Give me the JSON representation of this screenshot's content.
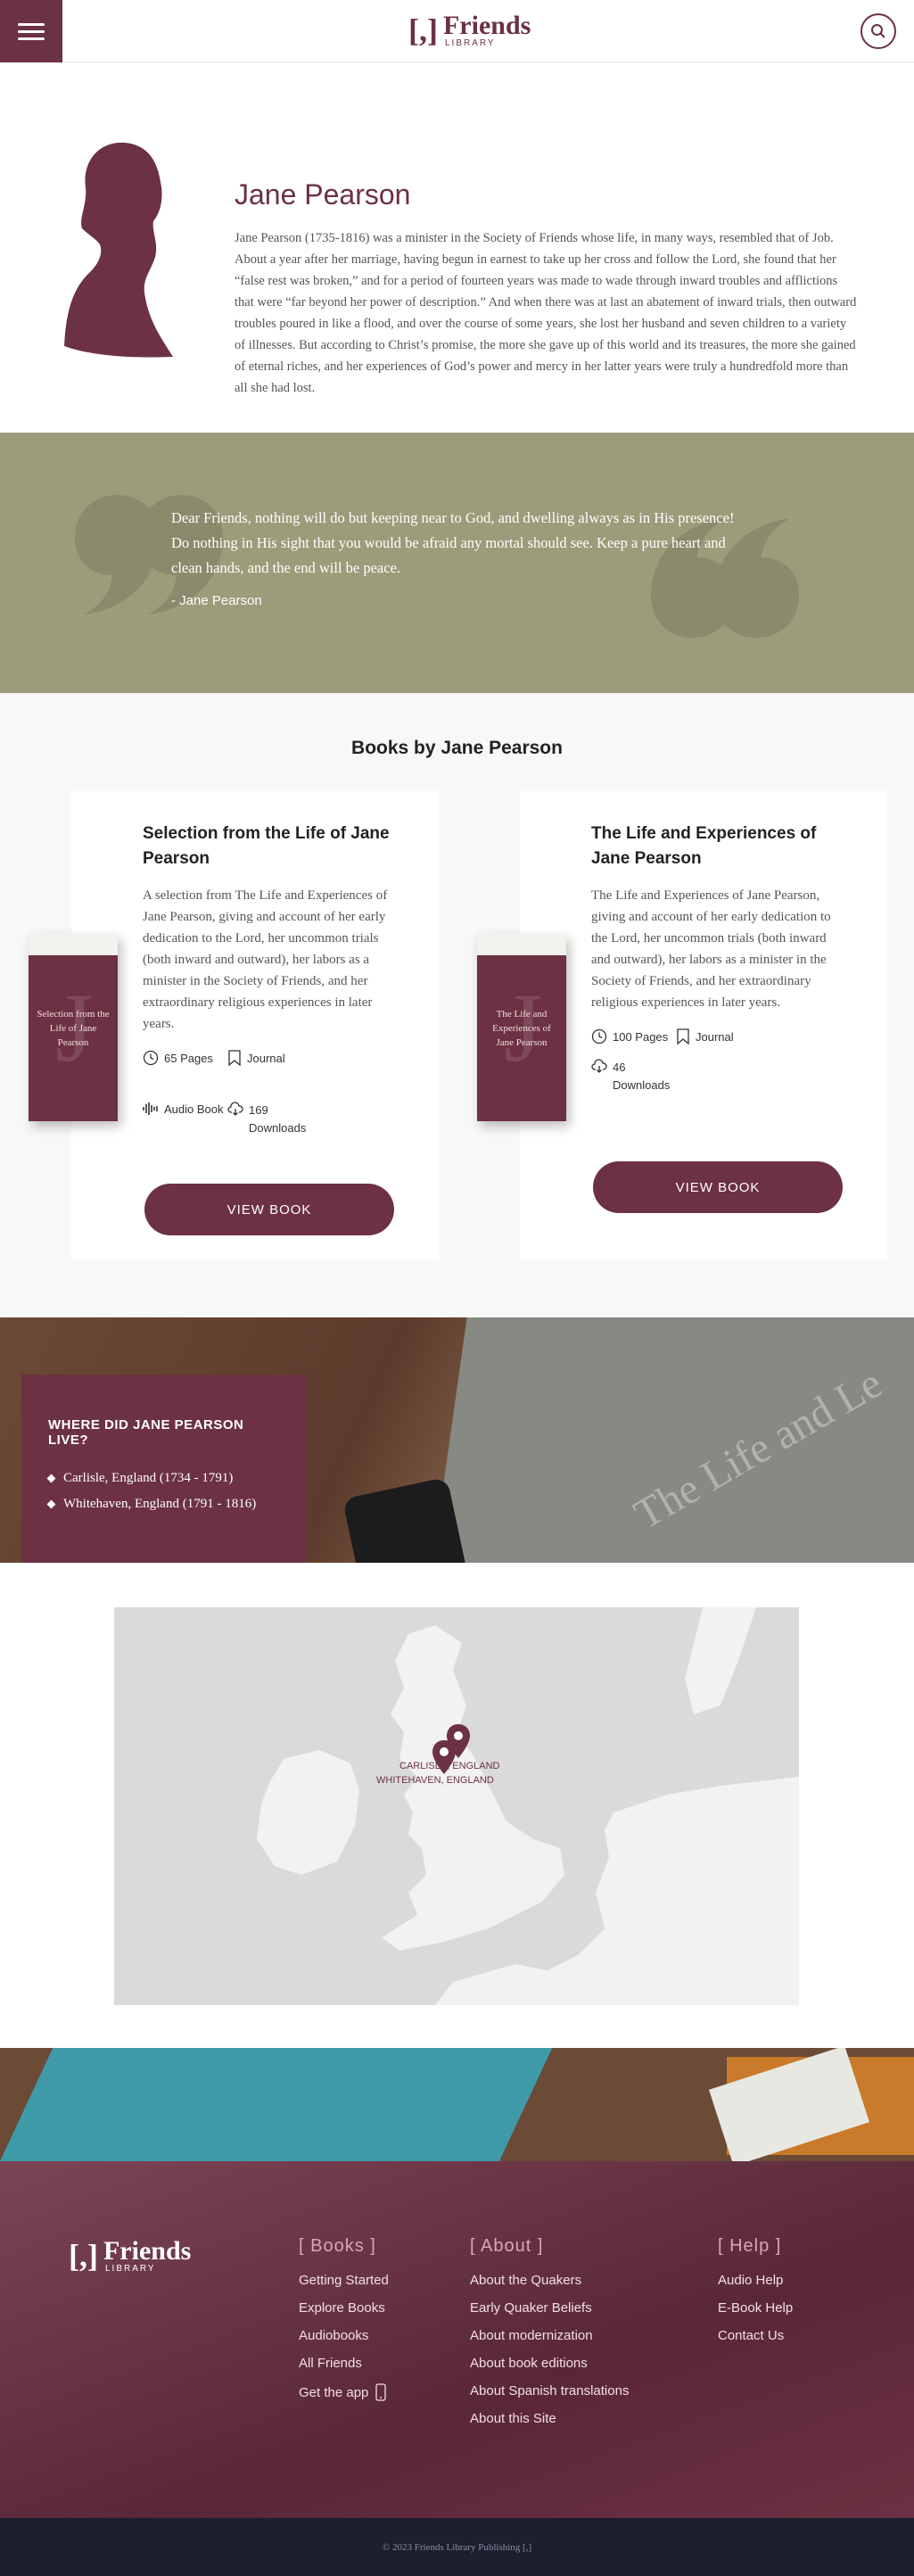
{
  "header": {
    "logo_bracket": "[,]",
    "logo_name": "Friends",
    "logo_sub": "LIBRARY"
  },
  "bio": {
    "name": "Jane Pearson",
    "text": "Jane Pearson (1735-1816) was a minister in the Society of Friends whose life, in many ways, resembled that of Job. About a year after her marriage, having begun in earnest to take up her cross and follow the Lord, she found that her “false rest was broken,” and for a period of fourteen years was made to wade through inward troubles and afflictions that were “far beyond her power of description.” And when there was at last an abatement of inward trials, then outward troubles poured in like a flood, and over the course of some years, she lost her husband and seven children to a variety of illnesses. But according to Christ’s promise, the more she gave up of this world and its treasures, the more she gained of eternal riches, and her experiences of God’s power and mercy in her latter years were truly a hundredfold more than all she had lost."
  },
  "quote": {
    "text": "Dear Friends, nothing will do but keeping near to God, and dwelling always as in His presence! Do nothing in His sight that you would be afraid any mortal should see. Keep a pure heart and clean hands, and the end will be peace.",
    "cite": "- Jane Pearson"
  },
  "books": {
    "title": "Books by Jane Pearson",
    "items": [
      {
        "title": "Selection from the Life of Jane Pearson",
        "cover_title": "Selection from the Life of Jane Pearson",
        "description": "A selection from The Life and Experiences of Jane Pearson, giving and account of her early dedication to the Lord, her uncommon trials (both inward and outward), her labors as a minister in the Society of Friends, and her extraordinary religious experiences in later years.",
        "pages": "65 Pages",
        "type": "Journal",
        "audio": "Audio Book",
        "downloads": "169 Downloads",
        "button": "VIEW BOOK"
      },
      {
        "title": "The Life and Experiences of Jane Pearson",
        "cover_title": "The Life and Experiences of Jane Pearson",
        "description": "The Life and Experiences of Jane Pearson, giving and account of her early dedication to the Lord, her uncommon trials (both inward and outward), her labors as a minister in the Society of Friends, and her extraordinary religious experiences in later years.",
        "pages": "100 Pages",
        "type": "Journal",
        "downloads": "46 Downloads",
        "button": "VIEW BOOK"
      }
    ]
  },
  "where": {
    "title": "WHERE DID JANE PEARSON LIVE?",
    "places": [
      "Carlisle, England (1734 - 1791)",
      "Whitehaven, England (1791 - 1816)"
    ]
  },
  "map": {
    "labels": [
      "CARLISLE, ENGLAND",
      "WHITEHAVEN, ENGLAND"
    ]
  },
  "footer": {
    "logo_bracket": "[,]",
    "logo_name": "Friends",
    "logo_sub": "LIBRARY",
    "columns": [
      {
        "heading": "[ Books ]",
        "links": [
          "Getting Started",
          "Explore Books",
          "Audiobooks",
          "All Friends",
          "Get the app"
        ]
      },
      {
        "heading": "[ About ]",
        "links": [
          "About the Quakers",
          "Early Quaker Beliefs",
          "About modernization",
          "About book editions",
          "About Spanish translations",
          "About this Site"
        ]
      },
      {
        "heading": "[ Help ]",
        "links": [
          "Audio Help",
          "E-Book Help",
          "Contact Us"
        ]
      }
    ],
    "copyright": "© 2023 Friends Library Publishing [,]"
  },
  "colors": {
    "brand": "#6c3142",
    "quote_bg": "#9b9c7a",
    "copyright_bg": "#1d1f2f"
  }
}
